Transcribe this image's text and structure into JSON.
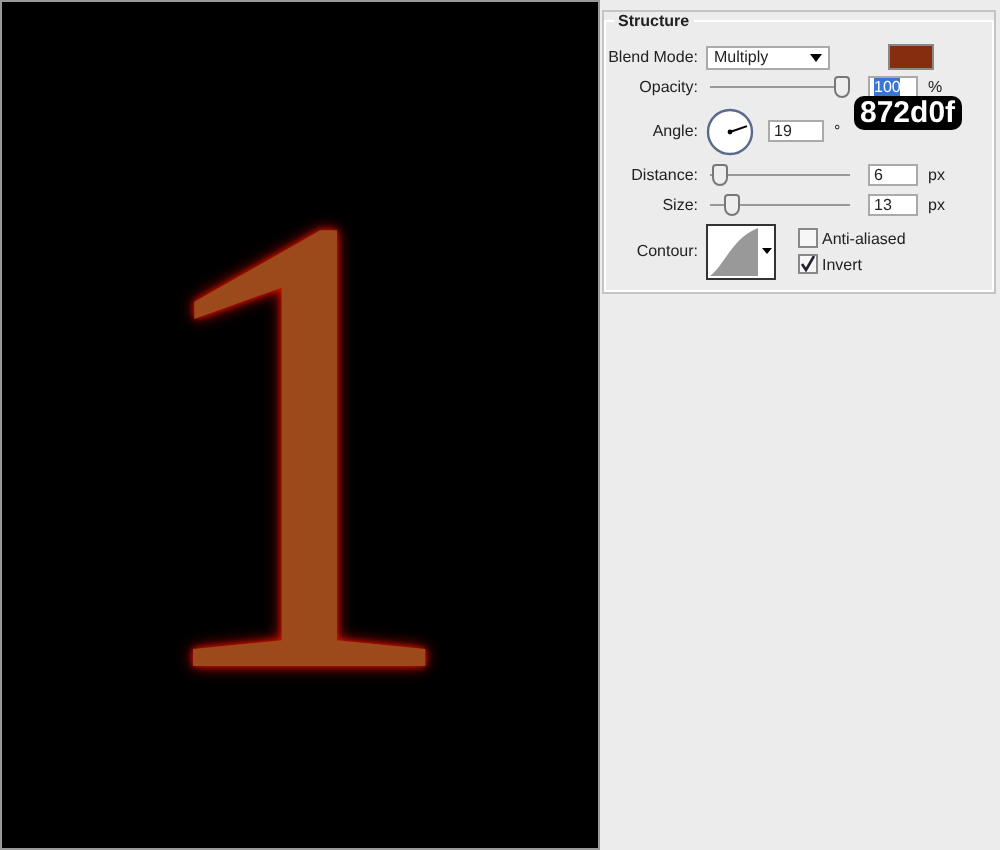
{
  "canvas": {
    "glyph": "1"
  },
  "panel": {
    "title": "Structure",
    "annotation": "872d0f",
    "rows": [
      {
        "kind": "select",
        "label": "Blend Mode:",
        "value": "Multiply",
        "color": "#872d0f"
      },
      {
        "kind": "slider",
        "label": "Opacity:",
        "level": 1,
        "value": "100",
        "unit": "%",
        "selected": true
      },
      {
        "kind": "dial",
        "label": "Angle:",
        "value": "19",
        "unit": "°"
      },
      {
        "kind": "slider",
        "label": "Distance:",
        "level": 0.02,
        "value": "6",
        "unit": "px",
        "selected": false
      },
      {
        "kind": "slider",
        "label": "Size:",
        "level": 0.12,
        "value": "13",
        "unit": "px",
        "selected": false
      },
      {
        "kind": "contour",
        "label": "Contour:",
        "options": [
          {
            "label": "Anti-aliased",
            "checked": false
          },
          {
            "label": "Invert",
            "checked": true
          }
        ]
      }
    ]
  }
}
